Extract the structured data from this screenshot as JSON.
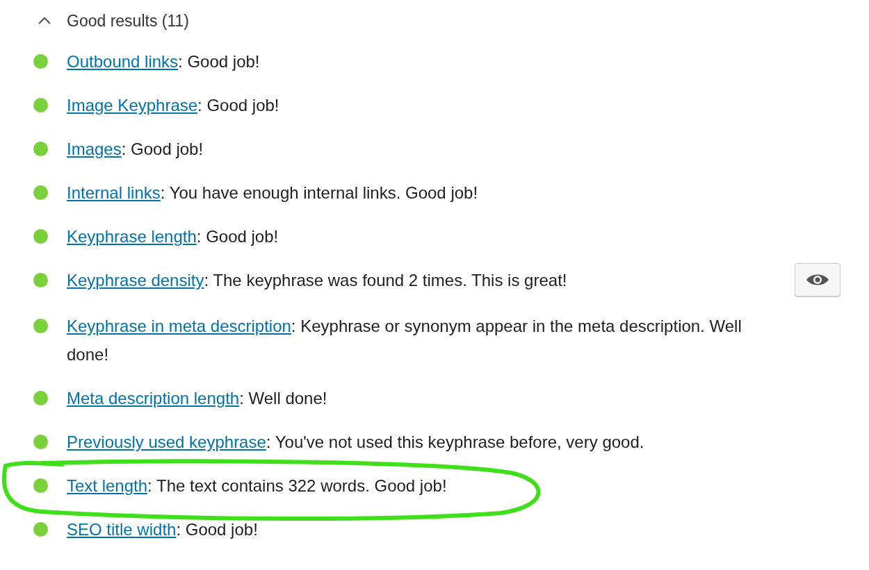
{
  "section": {
    "title": "Good results (11)",
    "expanded": true
  },
  "results": [
    {
      "link": "Outbound links",
      "text": ": Good job!",
      "highlighted": false,
      "eye_button": false
    },
    {
      "link": "Image Keyphrase",
      "text": ": Good job!",
      "highlighted": false,
      "eye_button": false
    },
    {
      "link": "Images",
      "text": ": Good job!",
      "highlighted": false,
      "eye_button": false
    },
    {
      "link": "Internal links",
      "text": ": You have enough internal links. Good job!",
      "highlighted": false,
      "eye_button": false
    },
    {
      "link": "Keyphrase length",
      "text": ": Good job!",
      "highlighted": false,
      "eye_button": false
    },
    {
      "link": "Keyphrase density",
      "text": ": The keyphrase was found 2 times. This is great!",
      "highlighted": false,
      "eye_button": true
    },
    {
      "link": "Keyphrase in meta description",
      "text": ": Keyphrase or synonym appear in the meta description. Well done!",
      "highlighted": false,
      "eye_button": false
    },
    {
      "link": "Meta description length",
      "text": ": Well done!",
      "highlighted": false,
      "eye_button": false
    },
    {
      "link": "Previously used keyphrase",
      "text": ": You've not used this keyphrase before, very good.",
      "highlighted": false,
      "eye_button": false
    },
    {
      "link": "Text length",
      "text": ": The text contains 322 words. Good job!",
      "highlighted": true,
      "eye_button": false
    },
    {
      "link": "SEO title width",
      "text": ": Good job!",
      "highlighted": false,
      "eye_button": false
    }
  ]
}
